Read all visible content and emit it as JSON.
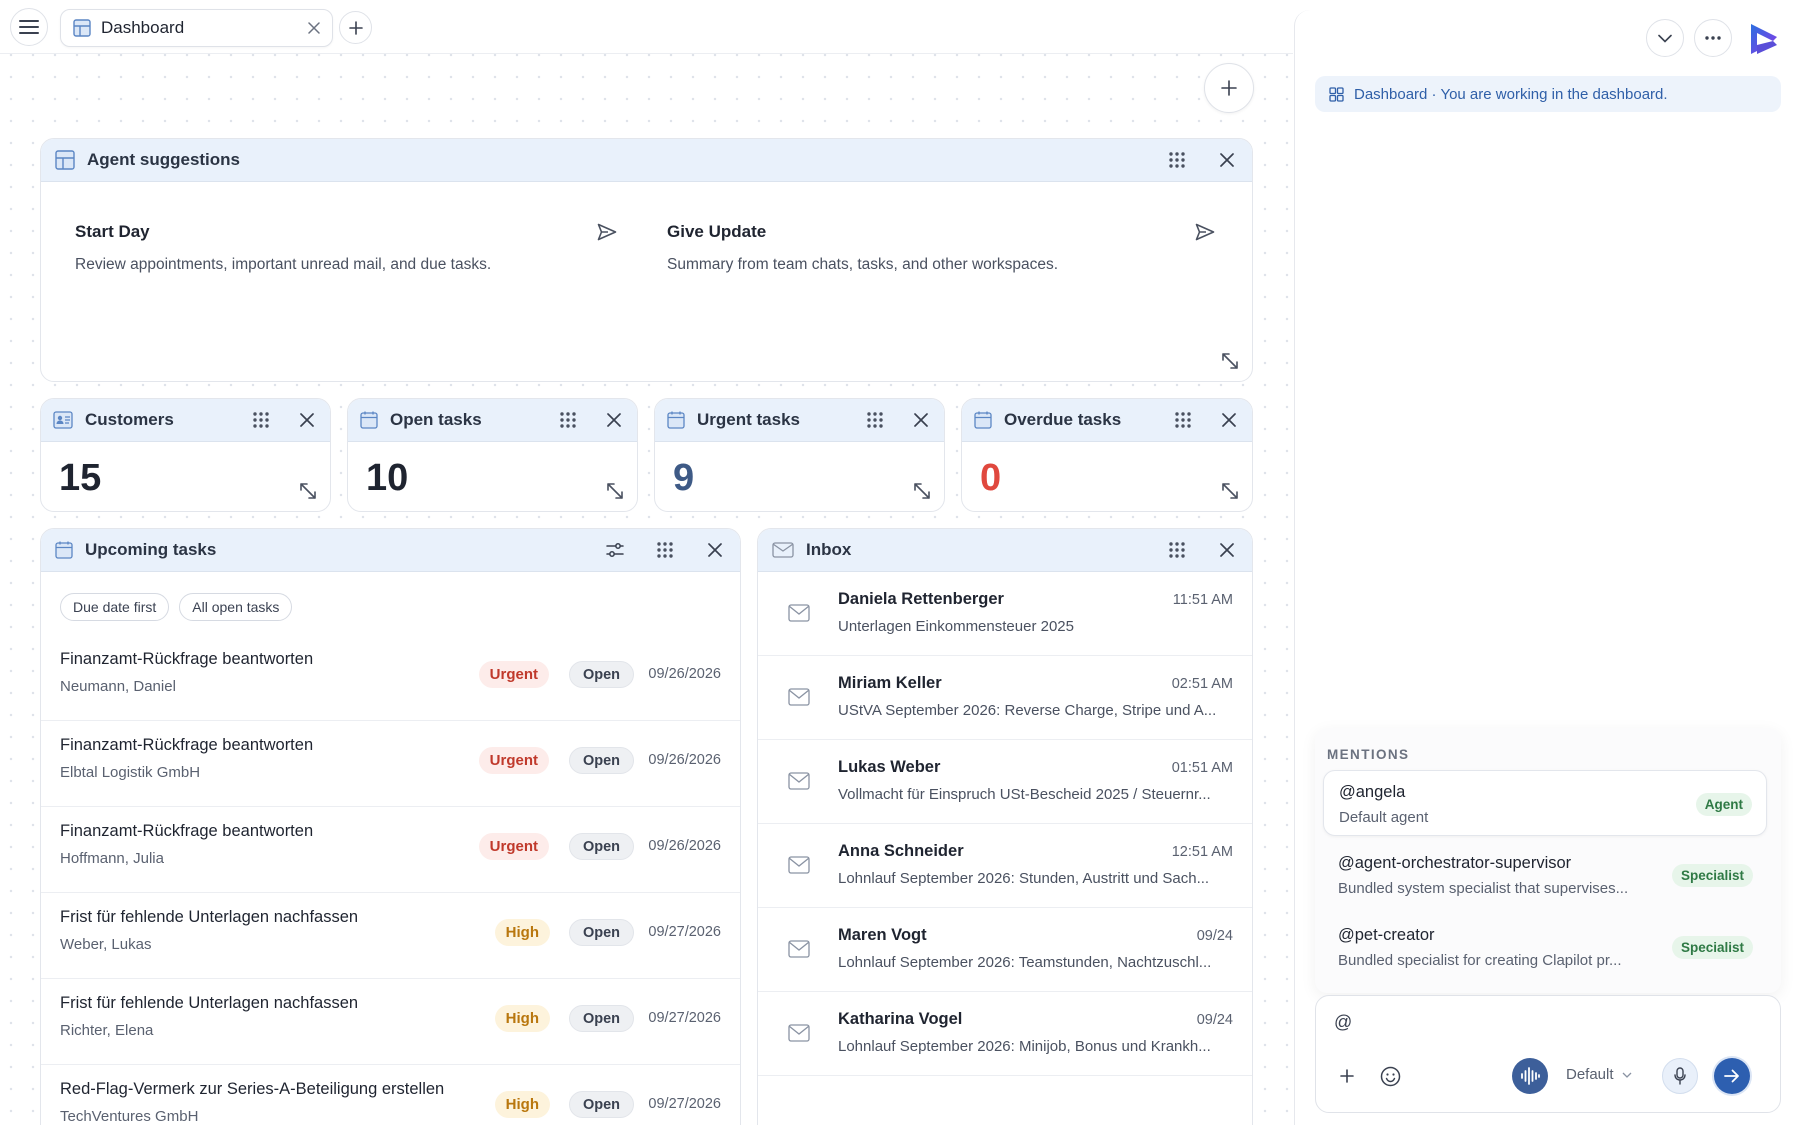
{
  "tab": {
    "title": "Dashboard"
  },
  "context": {
    "label": "Dashboard",
    "text": " · You are working in the dashboard."
  },
  "agent_suggestions": {
    "title": "Agent suggestions",
    "items": [
      {
        "title": "Start Day",
        "description": "Review appointments, important unread mail, and due tasks."
      },
      {
        "title": "Give Update",
        "description": "Summary from team chats, tasks, and other workspaces."
      }
    ]
  },
  "stats": [
    {
      "title": "Customers",
      "value": "15",
      "color": "#1f2430"
    },
    {
      "title": "Open tasks",
      "value": "10",
      "color": "#1f2430"
    },
    {
      "title": "Urgent tasks",
      "value": "9",
      "color": "#3e5a86"
    },
    {
      "title": "Overdue tasks",
      "value": "0",
      "color": "#e0483e"
    }
  ],
  "upcoming": {
    "title": "Upcoming tasks",
    "filters": [
      "Due date first",
      "All open tasks"
    ],
    "tasks": [
      {
        "title": "Finanzamt-Rückfrage beantworten",
        "client": "Neumann, Daniel",
        "priority": "Urgent",
        "status": "Open",
        "date": "09/26/2026"
      },
      {
        "title": "Finanzamt-Rückfrage beantworten",
        "client": "Elbtal Logistik GmbH",
        "priority": "Urgent",
        "status": "Open",
        "date": "09/26/2026"
      },
      {
        "title": "Finanzamt-Rückfrage beantworten",
        "client": "Hoffmann, Julia",
        "priority": "Urgent",
        "status": "Open",
        "date": "09/26/2026"
      },
      {
        "title": "Frist für fehlende Unterlagen nachfassen",
        "client": "Weber, Lukas",
        "priority": "High",
        "status": "Open",
        "date": "09/27/2026"
      },
      {
        "title": "Frist für fehlende Unterlagen nachfassen",
        "client": "Richter, Elena",
        "priority": "High",
        "status": "Open",
        "date": "09/27/2026"
      },
      {
        "title": "Red-Flag-Vermerk zur Series-A-Beteiligung erstellen",
        "client": "TechVentures GmbH",
        "priority": "High",
        "status": "Open",
        "date": "09/27/2026"
      }
    ]
  },
  "inbox": {
    "title": "Inbox",
    "messages": [
      {
        "from": "Daniela Rettenberger",
        "time": "11:51 AM",
        "subject": "Unterlagen Einkommensteuer 2025"
      },
      {
        "from": "Miriam Keller",
        "time": "02:51 AM",
        "subject": "UStVA September 2026: Reverse Charge, Stripe und A..."
      },
      {
        "from": "Lukas Weber",
        "time": "01:51 AM",
        "subject": "Vollmacht für Einspruch USt-Bescheid 2025 / Steuernr..."
      },
      {
        "from": "Anna Schneider",
        "time": "12:51 AM",
        "subject": "Lohnlauf September 2026: Stunden, Austritt und Sach..."
      },
      {
        "from": "Maren Vogt",
        "time": "09/24",
        "subject": "Lohnlauf September 2026: Teamstunden, Nachtzuschl..."
      },
      {
        "from": "Katharina Vogel",
        "time": "09/24",
        "subject": "Lohnlauf September 2026: Minijob, Bonus und Krankh..."
      }
    ]
  },
  "mentions": {
    "label": "MENTIONS",
    "items": [
      {
        "name": "@angela",
        "description": "Default agent",
        "badge": "Agent"
      },
      {
        "name": "@agent-orchestrator-supervisor",
        "description": "Bundled system specialist that supervises...",
        "badge": "Specialist"
      },
      {
        "name": "@pet-creator",
        "description": "Bundled specialist for creating Clapilot pr...",
        "badge": "Specialist"
      }
    ]
  },
  "composer": {
    "value": "@",
    "model": "Default"
  },
  "colors": {
    "accent": "#2f5fa8",
    "urgent_text": "#c0392b",
    "urgent_bg": "#fdecea",
    "high_text": "#b9770e",
    "high_bg": "#fdf3dc",
    "send": "#2d5fb0"
  }
}
